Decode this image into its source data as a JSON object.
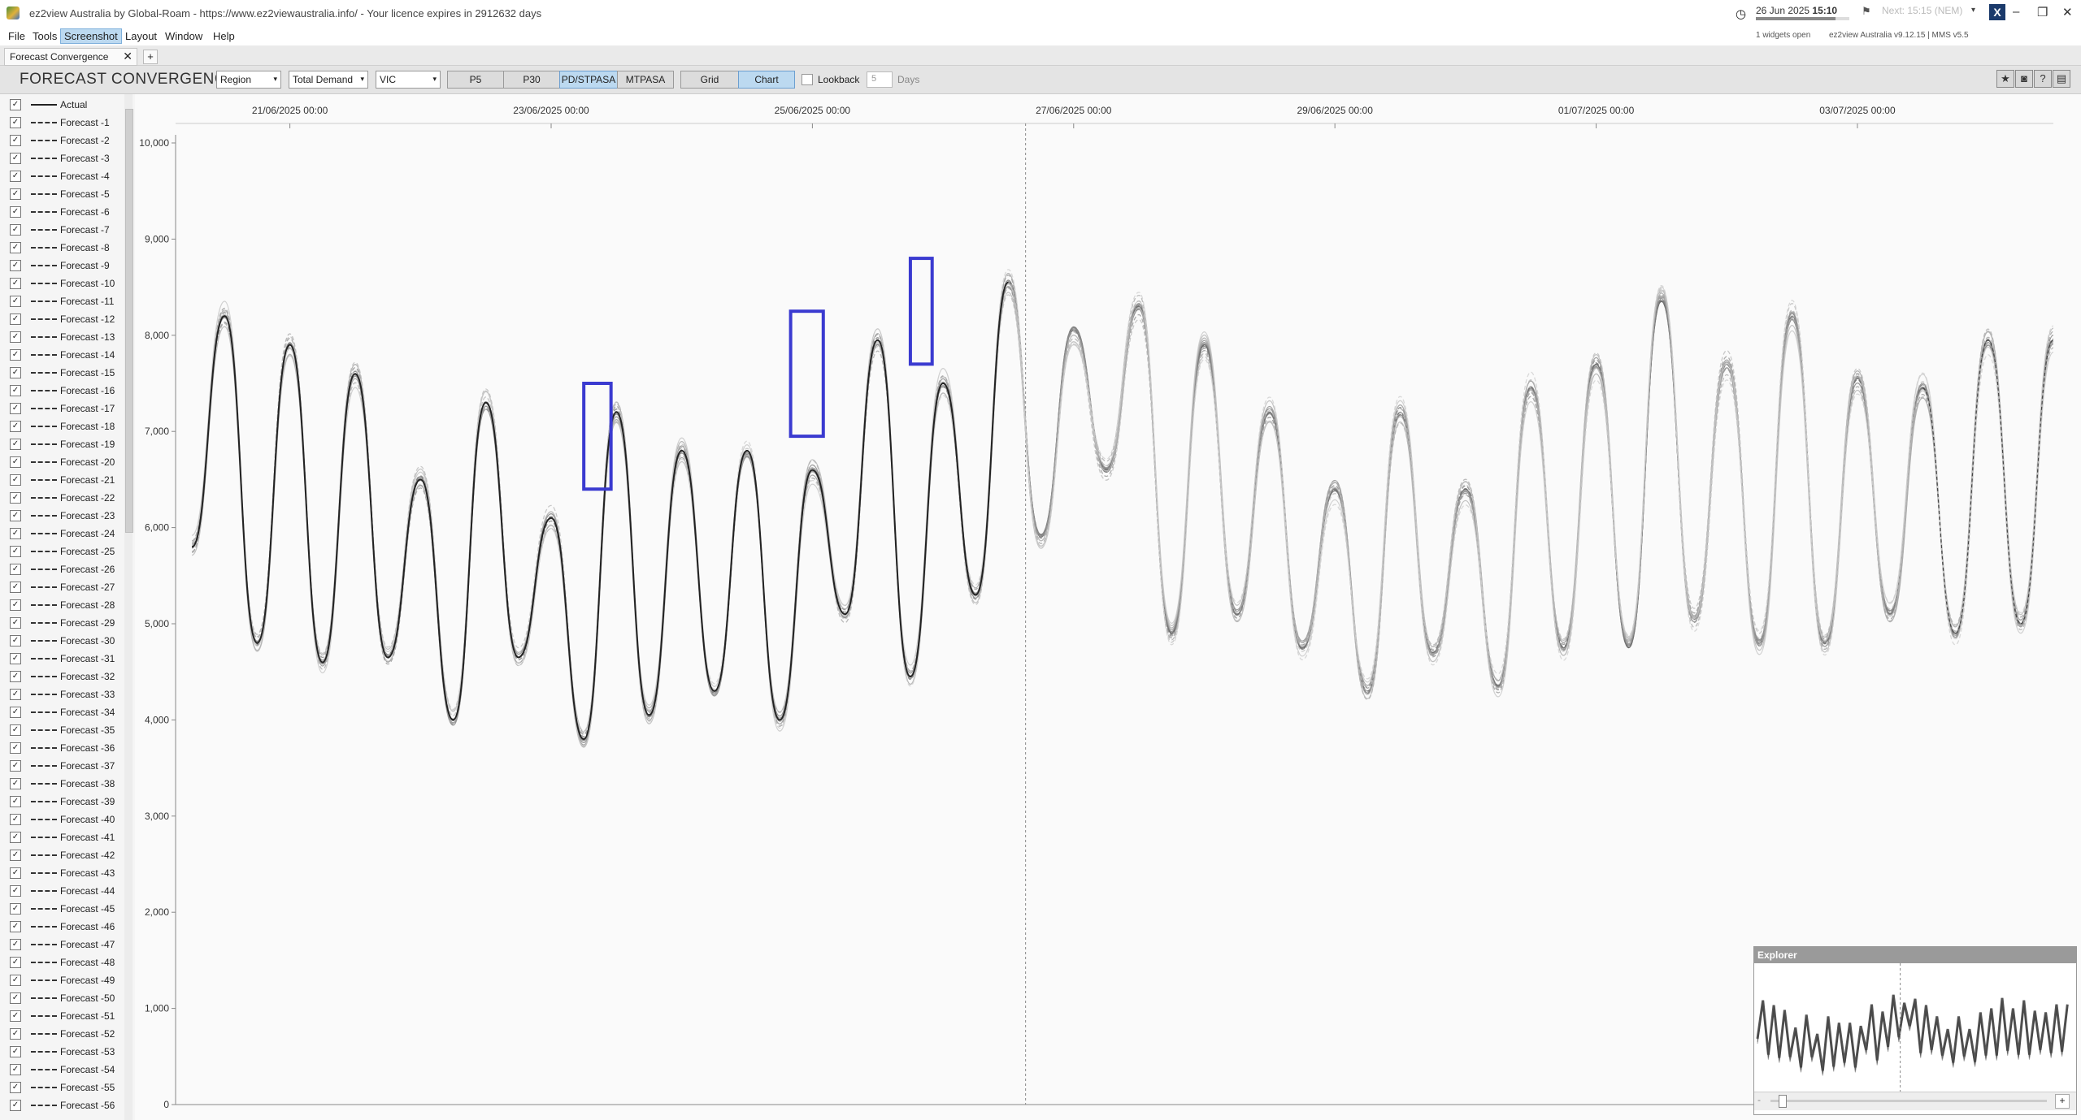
{
  "window": {
    "title": "ez2view Australia by Global-Roam - https://www.ez2viewaustralia.info/ - Your licence expires in 2912632 days",
    "clock_date": "26 Jun 2025",
    "clock_time": "15:10",
    "next_label": "Next: 15:15 (NEM)",
    "clock_progress": 0.85,
    "ez_button": "X",
    "widgets_open": "1 widgets open",
    "version": "ez2view Australia v9.12.15 | MMS v5.5"
  },
  "menu": {
    "items": [
      "File",
      "Tools",
      "Screenshot",
      "Layout",
      "Window",
      "Help"
    ],
    "active": "Screenshot"
  },
  "tabs": {
    "active_tab": "Forecast Convergence",
    "close": "✕",
    "add": "+"
  },
  "toolbar": {
    "title": "FORECAST CONVERGENCE",
    "dropdown_region": "Region",
    "dropdown_measure": "Total Demand",
    "dropdown_state": "VIC",
    "seg_p5": "P5",
    "seg_p30": "P30",
    "seg_pd": "PD/STPASA",
    "seg_mtpasa": "MTPASA",
    "seg_grid": "Grid",
    "seg_chart": "Chart",
    "lookback_label": "Lookback",
    "lookback_value": "5",
    "days_label": "Days",
    "icons": [
      "star-icon",
      "camera-icon",
      "help-icon",
      "comment-icon"
    ],
    "dropdown_arrow": "▾"
  },
  "legend": {
    "check": "✓",
    "actual": "Actual",
    "forecasts": [
      "Forecast -1",
      "Forecast -2",
      "Forecast -3",
      "Forecast -4",
      "Forecast -5",
      "Forecast -6",
      "Forecast -7",
      "Forecast -8",
      "Forecast -9",
      "Forecast -10",
      "Forecast -11",
      "Forecast -12",
      "Forecast -13",
      "Forecast -14",
      "Forecast -15",
      "Forecast -16",
      "Forecast -17",
      "Forecast -18",
      "Forecast -19",
      "Forecast -20",
      "Forecast -21",
      "Forecast -22",
      "Forecast -23",
      "Forecast -24",
      "Forecast -25",
      "Forecast -26",
      "Forecast -27",
      "Forecast -28",
      "Forecast -29",
      "Forecast -30",
      "Forecast -31",
      "Forecast -32",
      "Forecast -33",
      "Forecast -34",
      "Forecast -35",
      "Forecast -36",
      "Forecast -37",
      "Forecast -38",
      "Forecast -39",
      "Forecast -40",
      "Forecast -41",
      "Forecast -42",
      "Forecast -43",
      "Forecast -44",
      "Forecast -45",
      "Forecast -46",
      "Forecast -47",
      "Forecast -48",
      "Forecast -49",
      "Forecast -50",
      "Forecast -51",
      "Forecast -52",
      "Forecast -53",
      "Forecast -54",
      "Forecast -55",
      "Forecast -56"
    ]
  },
  "explorer": {
    "title": "Explorer",
    "plus": "+",
    "minus": "-"
  },
  "chart_data": {
    "type": "line",
    "title": "",
    "xlabel": "",
    "ylabel": "",
    "ylim": [
      0,
      10000
    ],
    "yticks": [
      0,
      1000,
      2000,
      3000,
      4000,
      5000,
      6000,
      7000,
      8000,
      9000,
      10000
    ],
    "ytick_labels": [
      "0",
      "1,000",
      "2,000",
      "3,000",
      "4,000",
      "5,000",
      "6,000",
      "7,000",
      "8,000",
      "9,000",
      "10,000"
    ],
    "x_range": [
      "2025-06-20T03:00",
      "2025-07-04T12:00"
    ],
    "x_tick_dates": [
      "2025-06-21T00:00",
      "2025-06-23T00:00",
      "2025-06-25T00:00",
      "2025-06-27T00:00",
      "2025-06-29T00:00",
      "2025-07-01T00:00",
      "2025-07-03T00:00"
    ],
    "x_tick_labels": [
      "21/06/2025 00:00",
      "23/06/2025 00:00",
      "25/06/2025 00:00",
      "27/06/2025 00:00",
      "29/06/2025 00:00",
      "01/07/2025 00:00",
      "03/07/2025 00:00"
    ],
    "now_marker": "2025-06-26T15:10",
    "grid": false,
    "legend": "left",
    "highlights": [
      {
        "x_from": "2025-06-23T06:00",
        "x_to": "2025-06-23T11:00",
        "y_from": 6400,
        "y_to": 7500
      },
      {
        "x_from": "2025-06-24T20:00",
        "x_to": "2025-06-25T02:00",
        "y_from": 6950,
        "y_to": 8250
      },
      {
        "x_from": "2025-06-25T18:00",
        "x_to": "2025-06-25T22:00",
        "y_from": 7700,
        "y_to": 8800
      }
    ],
    "highlight_color": "#3a3ad0",
    "series": [
      {
        "name": "Actual",
        "x": [
          "2025-06-20T06:00",
          "2025-06-20T18:00",
          "2025-06-21T05:00",
          "2025-06-21T18:00",
          "2025-06-22T05:00",
          "2025-06-22T18:00",
          "2025-06-23T05:00",
          "2025-06-23T18:00",
          "2025-06-24T05:00",
          "2025-06-24T18:00",
          "2025-06-25T05:00",
          "2025-06-25T18:00",
          "2025-06-26T05:00",
          "2025-06-26T15:10"
        ],
        "values": [
          5800,
          8200,
          4650,
          7900,
          4600,
          7600,
          4650,
          7300,
          3950,
          7200,
          4050,
          7900,
          4500,
          8200
        ]
      }
    ],
    "peaks": [
      8200,
      7900,
      7600,
      6500,
      7300,
      6100,
      7200,
      6800,
      6800,
      6600,
      7950,
      7500,
      8550,
      8050,
      8300,
      7900,
      7200,
      6400,
      7200,
      6400,
      7450,
      7700,
      8350,
      7700,
      8200,
      7550,
      7450,
      7950,
      7950
    ],
    "troughs": [
      5800,
      4800,
      4600,
      4650,
      4000,
      4650,
      3800,
      4050,
      4300,
      4000,
      5100,
      4450,
      5300,
      5900,
      6600,
      4900,
      5100,
      4750,
      4300,
      4700,
      4350,
      4750,
      4750,
      5050,
      4800,
      4800,
      5100,
      4900,
      5000,
      4900
    ],
    "explorer_series_ylim": [
      0,
      10000
    ]
  }
}
